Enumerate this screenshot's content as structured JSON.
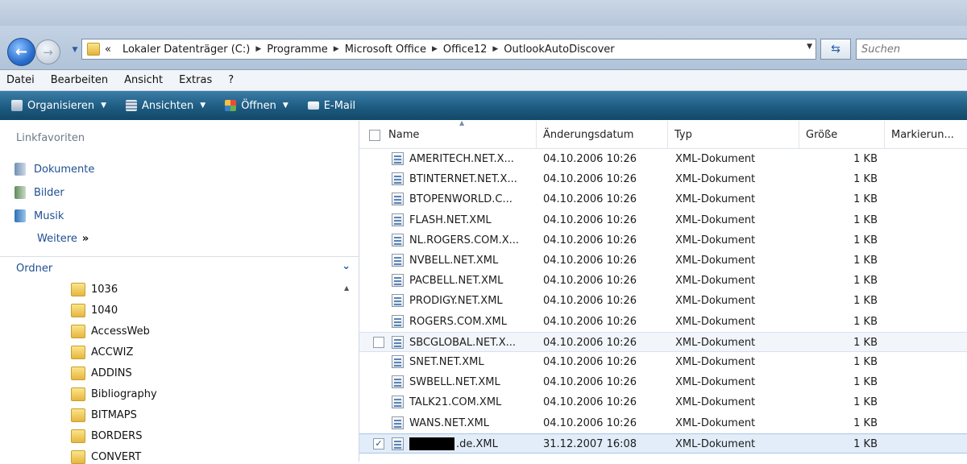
{
  "navigation": {
    "breadcrumb_prefix": "«",
    "breadcrumbs": [
      "Lokaler Datenträger (C:)",
      "Programme",
      "Microsoft Office",
      "Office12",
      "OutlookAutoDiscover"
    ],
    "search_placeholder": "Suchen"
  },
  "menubar": [
    "Datei",
    "Bearbeiten",
    "Ansicht",
    "Extras",
    "?"
  ],
  "toolbar": {
    "organize": "Organisieren",
    "views": "Ansichten",
    "open": "Öffnen",
    "email": "E-Mail"
  },
  "sidebar": {
    "favorites_heading": "Linkfavoriten",
    "favorites": [
      "Dokumente",
      "Bilder",
      "Musik"
    ],
    "more": "Weitere",
    "more_glyph": "»",
    "folders_heading": "Ordner",
    "folders": [
      "1036",
      "1040",
      "AccessWeb",
      "ACCWIZ",
      "ADDINS",
      "Bibliography",
      "BITMAPS",
      "BORDERS",
      "CONVERT"
    ]
  },
  "columns": {
    "name": "Name",
    "date": "Änderungsdatum",
    "type": "Typ",
    "size": "Größe",
    "tags": "Markierun..."
  },
  "files": [
    {
      "name": "AMERITECH.NET.X...",
      "date": "04.10.2006 10:26",
      "type": "XML-Dokument",
      "size": "1 KB"
    },
    {
      "name": "BTINTERNET.NET.X...",
      "date": "04.10.2006 10:26",
      "type": "XML-Dokument",
      "size": "1 KB"
    },
    {
      "name": "BTOPENWORLD.C...",
      "date": "04.10.2006 10:26",
      "type": "XML-Dokument",
      "size": "1 KB"
    },
    {
      "name": "FLASH.NET.XML",
      "date": "04.10.2006 10:26",
      "type": "XML-Dokument",
      "size": "1 KB"
    },
    {
      "name": "NL.ROGERS.COM.X...",
      "date": "04.10.2006 10:26",
      "type": "XML-Dokument",
      "size": "1 KB"
    },
    {
      "name": "NVBELL.NET.XML",
      "date": "04.10.2006 10:26",
      "type": "XML-Dokument",
      "size": "1 KB"
    },
    {
      "name": "PACBELL.NET.XML",
      "date": "04.10.2006 10:26",
      "type": "XML-Dokument",
      "size": "1 KB"
    },
    {
      "name": "PRODIGY.NET.XML",
      "date": "04.10.2006 10:26",
      "type": "XML-Dokument",
      "size": "1 KB"
    },
    {
      "name": "ROGERS.COM.XML",
      "date": "04.10.2006 10:26",
      "type": "XML-Dokument",
      "size": "1 KB"
    },
    {
      "name": "SBCGLOBAL.NET.X...",
      "date": "04.10.2006 10:26",
      "type": "XML-Dokument",
      "size": "1 KB"
    },
    {
      "name": "SNET.NET.XML",
      "date": "04.10.2006 10:26",
      "type": "XML-Dokument",
      "size": "1 KB"
    },
    {
      "name": "SWBELL.NET.XML",
      "date": "04.10.2006 10:26",
      "type": "XML-Dokument",
      "size": "1 KB"
    },
    {
      "name": "TALK21.COM.XML",
      "date": "04.10.2006 10:26",
      "type": "XML-Dokument",
      "size": "1 KB"
    },
    {
      "name": "WANS.NET.XML",
      "date": "04.10.2006 10:26",
      "type": "XML-Dokument",
      "size": "1 KB"
    },
    {
      "name": ".de.XML",
      "date": "31.12.2007 16:08",
      "type": "XML-Dokument",
      "size": "1 KB"
    }
  ],
  "colors": {
    "command_bar": "#1e5c82",
    "link": "#1f4f92",
    "selection": "#e2edf9"
  }
}
